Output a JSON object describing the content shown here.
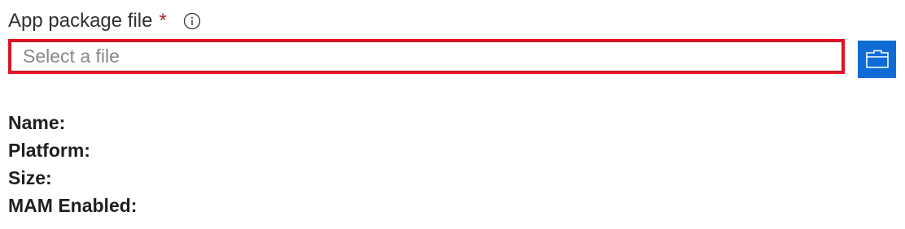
{
  "field": {
    "label": "App package file",
    "required_marker": "*",
    "info_icon": "info-circle-icon",
    "input_value": "",
    "input_placeholder": "Select a file",
    "browse_icon": "folder-icon"
  },
  "details": [
    {
      "label": "Name:",
      "value": ""
    },
    {
      "label": "Platform:",
      "value": ""
    },
    {
      "label": "Size:",
      "value": ""
    },
    {
      "label": "MAM Enabled:",
      "value": ""
    }
  ],
  "colors": {
    "error_border": "#e81123",
    "required_star": "#a4262c",
    "browse_button": "#0f6cd6",
    "placeholder": "#8a8886"
  }
}
